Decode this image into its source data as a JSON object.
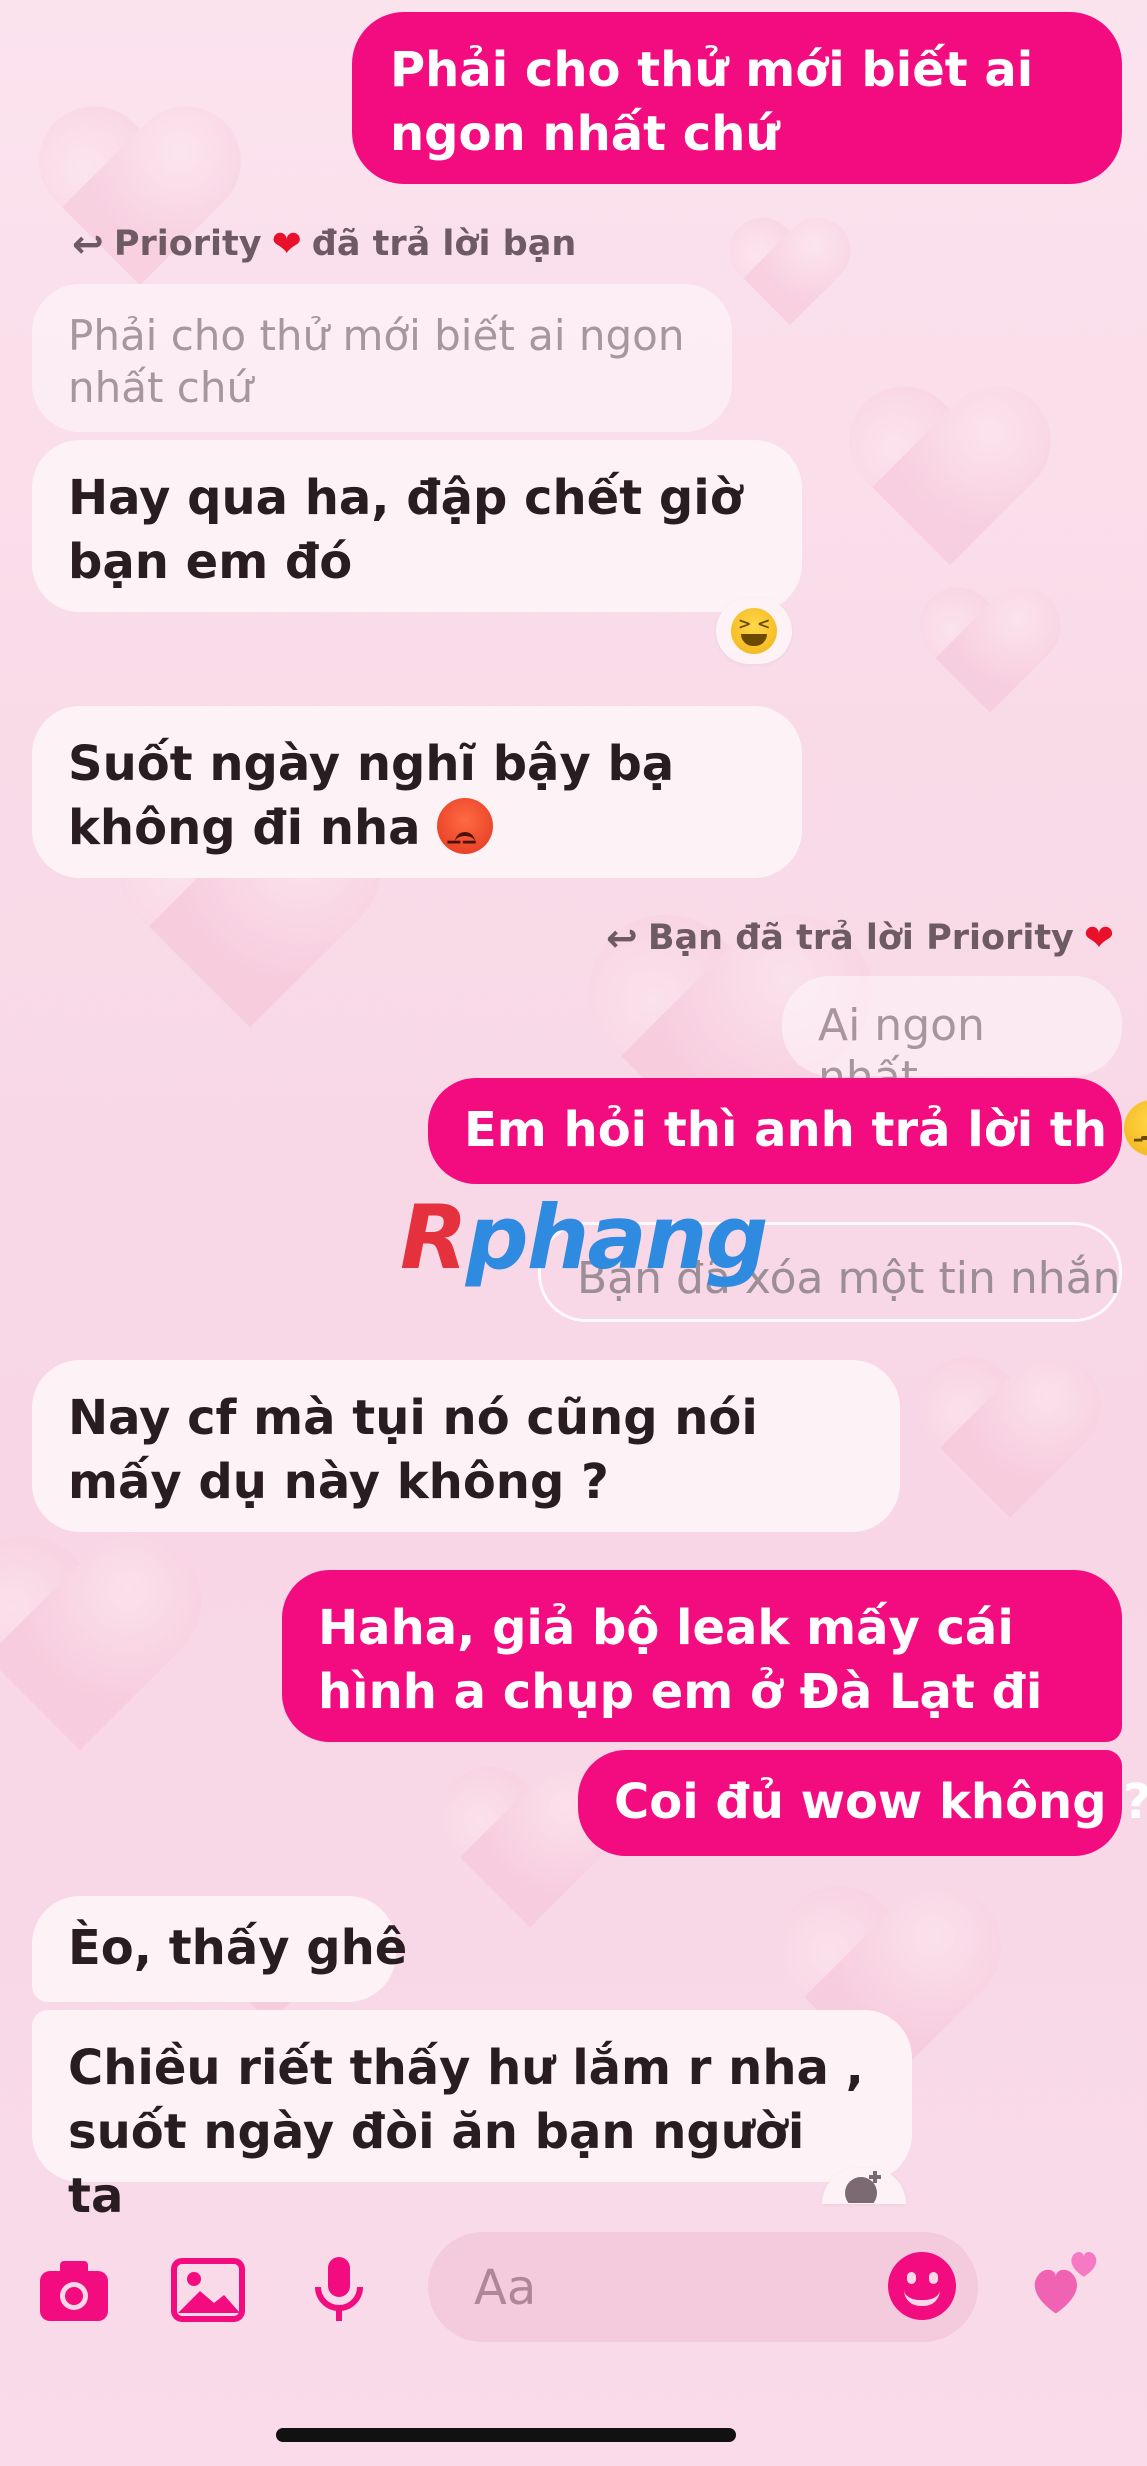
{
  "messages": {
    "m1": "Phải cho thử mới biết ai ngon nhất chứ",
    "reply_note_1": "Priority",
    "reply_note_1_suffix": "đã trả lời bạn",
    "quoted_1": "Phải cho thử mới biết ai ngon nhất chứ",
    "m2": "Hay qua ha, đập chết giờ bạn em đó",
    "m3": "Suốt ngày nghĩ bậy bạ không đi nha",
    "reply_note_2": "Bạn đã trả lời Priority",
    "quoted_2": "Ai ngon nhất",
    "m4": "Em hỏi thì anh trả lời th",
    "deleted": "Bạn đã xóa một tin nhắn",
    "m5": "Nay cf mà tụi nó cũng nói mấy dụ này không ?",
    "m6": "Haha, giả bộ leak mấy cái hình a chụp em ở Đà Lạt đi",
    "m7": "Coi đủ wow không ?",
    "m8": "Èo, thấy ghê",
    "m9": "Chiều riết thấy hư lắm r nha , suốt ngày đòi ăn bạn người ta"
  },
  "watermark": {
    "r": "R",
    "rest": "phang"
  },
  "composer": {
    "placeholder": "Aa"
  },
  "icons": [
    "camera-icon",
    "image-icon",
    "microphone-icon",
    "emoji-icon",
    "hearts-icon",
    "reply-arrow-icon",
    "laughing-emoji-icon",
    "angry-emoji-icon",
    "expressionless-emoji-icon",
    "add-reaction-icon"
  ],
  "colors": {
    "outgoing": "#f20c7f",
    "incoming": "#fdf3f6",
    "heart": "#e8102b"
  }
}
